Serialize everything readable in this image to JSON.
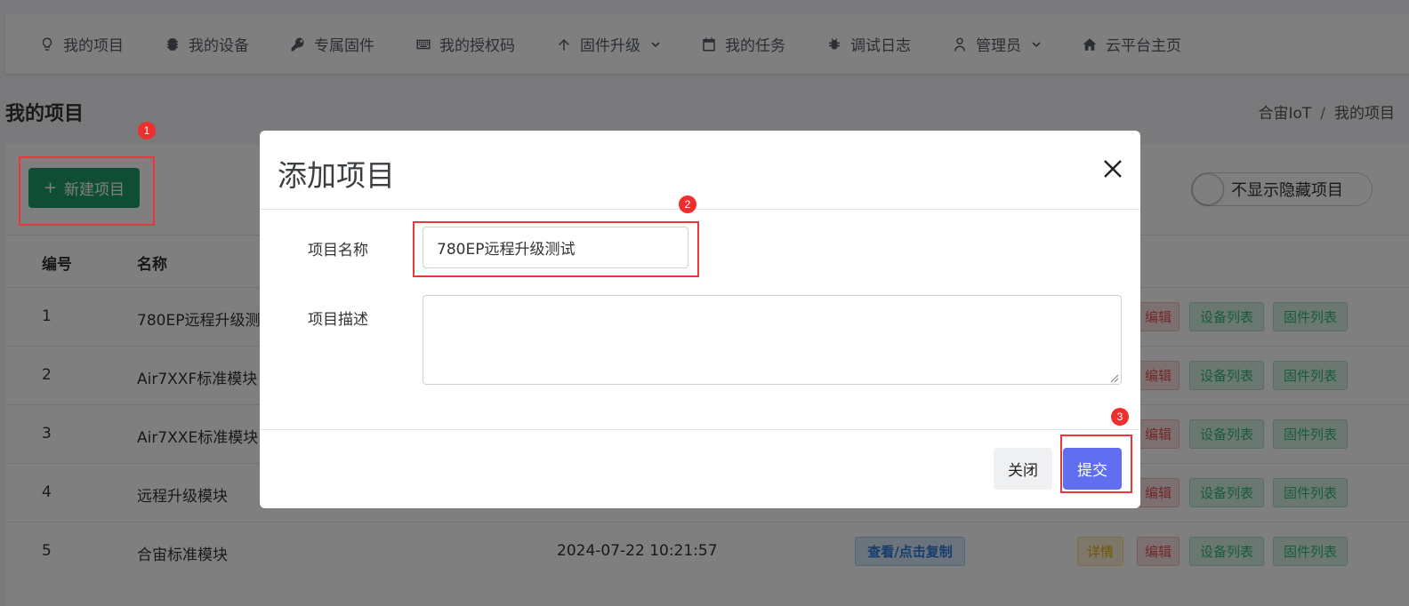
{
  "nav": {
    "items": [
      {
        "label": "我的项目",
        "icon": "lightbulb-icon"
      },
      {
        "label": "我的设备",
        "icon": "chip-icon"
      },
      {
        "label": "专属固件",
        "icon": "key-icon"
      },
      {
        "label": "我的授权码",
        "icon": "keyboard-icon"
      },
      {
        "label": "固件升级",
        "icon": "arrow-up-icon"
      },
      {
        "label": "我的任务",
        "icon": "calendar-icon"
      },
      {
        "label": "调试日志",
        "icon": "bug-icon"
      },
      {
        "label": "管理员",
        "icon": "user-icon"
      },
      {
        "label": "云平台主页",
        "icon": "home-icon"
      }
    ]
  },
  "page": {
    "title": "我的项目",
    "breadcrumb": [
      "合宙IoT",
      "我的项目"
    ]
  },
  "toolbar": {
    "new_project": "新建项目",
    "plus": "+",
    "toggle_label": "不显示隐藏项目"
  },
  "table": {
    "headers": [
      "编号",
      "名称"
    ],
    "rows": [
      {
        "id": "1",
        "name": "780EP远程升级测"
      },
      {
        "id": "2",
        "name": "Air7XXF标准模块"
      },
      {
        "id": "3",
        "name": "Air7XXE标准模块"
      },
      {
        "id": "4",
        "name": "远程升级模块"
      },
      {
        "id": "5",
        "name": "合宙标准模块",
        "time": "2024-07-22 10:21:57",
        "copy": "查看/点击复制",
        "detail": "详情"
      }
    ],
    "actions": {
      "edit": "编辑",
      "devices": "设备列表",
      "firmware": "固件列表"
    }
  },
  "modal": {
    "title": "添加项目",
    "name_label": "项目名称",
    "name_value": "780EP远程升级测试",
    "desc_label": "项目描述",
    "desc_value": "",
    "close": "关闭",
    "submit": "提交"
  },
  "annotations": [
    "1",
    "2",
    "3"
  ],
  "colors": {
    "primary_green": "#1f9d6b",
    "submit_blue": "#5f6ff0",
    "highlight_red": "#e8383d"
  }
}
